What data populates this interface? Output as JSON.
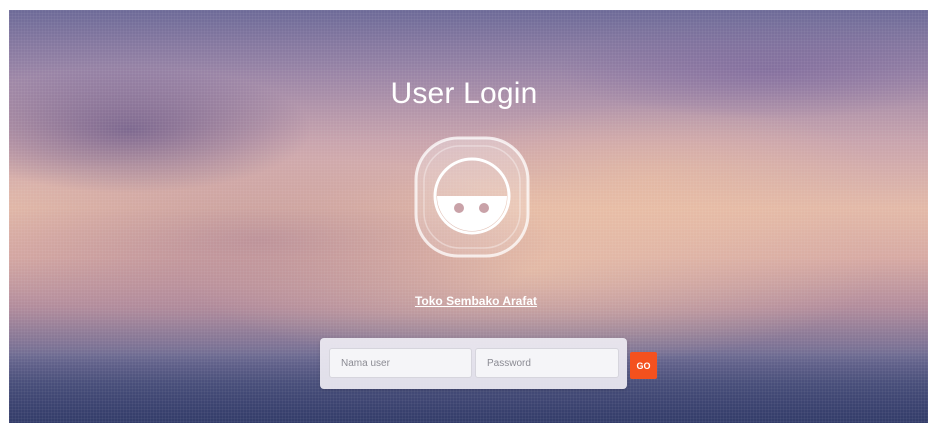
{
  "page": {
    "title": "User Login"
  },
  "avatar": {
    "icon": "user-avatar-icon"
  },
  "shop": {
    "link_label": "Toko Sembako Arafat"
  },
  "login": {
    "username_placeholder": "Nama user",
    "username_value": "",
    "password_placeholder": "Password",
    "password_value": "",
    "submit_label": "GO"
  },
  "colors": {
    "accent": "#f4511e",
    "text": "#ffffff"
  }
}
